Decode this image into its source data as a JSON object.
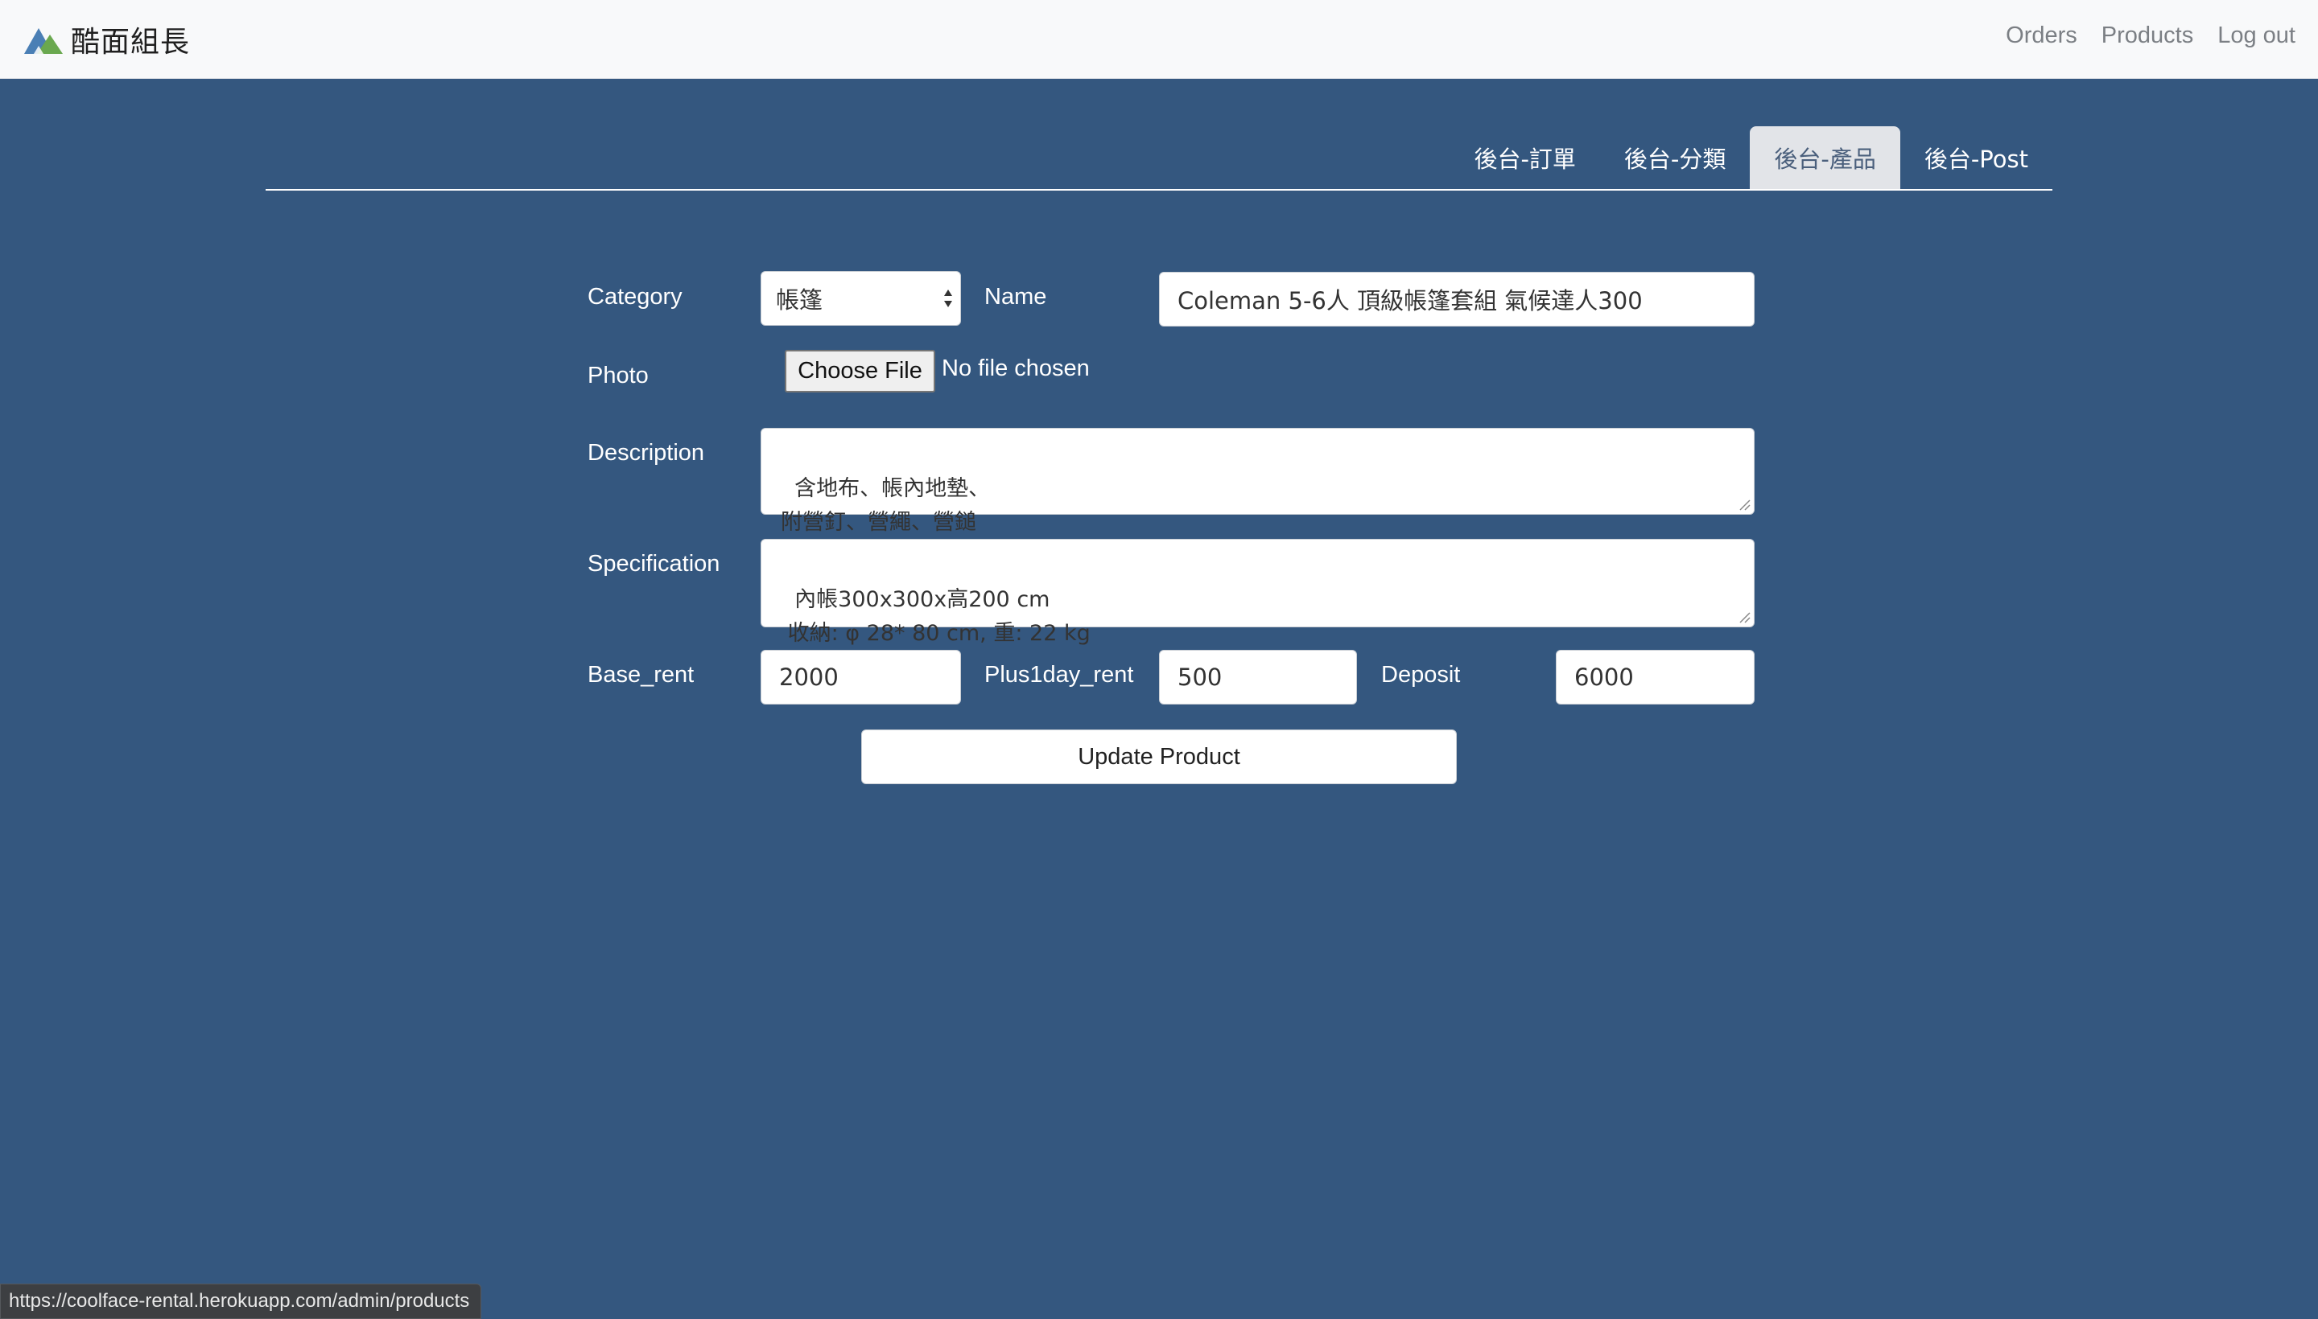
{
  "navbar": {
    "brand": "酷面組長",
    "links": [
      "Orders",
      "Products",
      "Log out"
    ]
  },
  "tabs": [
    {
      "label": "後台-訂單",
      "active": false
    },
    {
      "label": "後台-分類",
      "active": false
    },
    {
      "label": "後台-產品",
      "active": true
    },
    {
      "label": "後台-Post",
      "active": false
    }
  ],
  "form": {
    "category": {
      "label": "Category",
      "value": "帳篷"
    },
    "name": {
      "label": "Name",
      "value": "Coleman 5-6人 頂級帳篷套組 氣候達人300"
    },
    "photo": {
      "label": "Photo",
      "button": "Choose File",
      "status": "No file chosen"
    },
    "description": {
      "label": "Description",
      "value": "含地布、帳內地墊、\n附營釘、營繩、營鎚"
    },
    "specification": {
      "label": "Specification",
      "value": "內帳300x300x高200 cm\n 收納: φ 28* 80 cm, 重: 22 kg"
    },
    "base_rent": {
      "label": "Base_rent",
      "value": "2000"
    },
    "plus1day_rent": {
      "label": "Plus1day_rent",
      "value": "500"
    },
    "deposit": {
      "label": "Deposit",
      "value": "6000"
    },
    "submit": "Update Product"
  },
  "statusbar": {
    "url": "https://coolface-rental.herokuapp.com/admin/products"
  },
  "colors": {
    "background": "#34577f",
    "navbar": "#f8f9fa",
    "active_tab": "#e2e4e8"
  }
}
